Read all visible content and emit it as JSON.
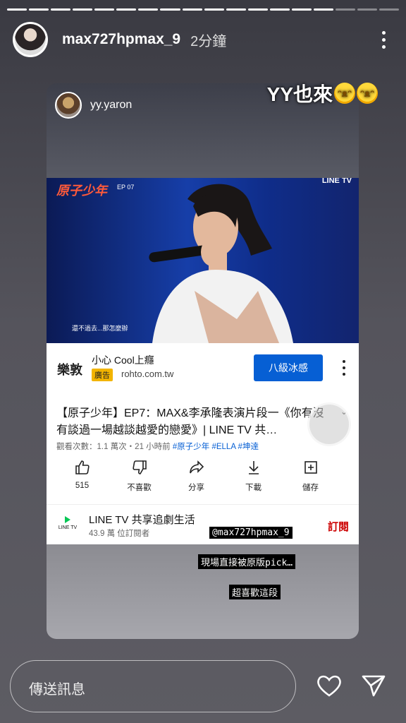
{
  "story": {
    "progress": {
      "total": 18,
      "completed": 15
    },
    "header": {
      "username": "max727hpmax_9",
      "time": "2分鐘"
    },
    "overlay_text": "YY也來",
    "overlay_emoji": [
      "rolling-on-floor-laughing",
      "rolling-on-floor-laughing"
    ],
    "reply_placeholder": "傳送訊息"
  },
  "shared_post": {
    "username": "yy.yaron",
    "video": {
      "show_logo": "原子少年",
      "episode": "EP 07",
      "watermark": "LINE TV",
      "subtitle": "還不過去...那怎麼辦"
    },
    "ad": {
      "logo": "樂敦",
      "name": "小心 Cool上癮",
      "badge": "廣告",
      "domain": "rohto.com.tw",
      "cta": "八級冰感"
    },
    "video_title": "【原子少年】EP7：MAX&李承隆表演片段一《你有沒有談過一場越談越愛的戀愛》| LINE TV 共…",
    "meta": "觀看次數：1.1 萬次・21 小時前 ",
    "tags": "#原子少年 #ELLA #坤達",
    "actions": [
      {
        "icon": "thumbs-up-icon",
        "label": "515"
      },
      {
        "icon": "thumbs-down-icon",
        "label": "不喜歡"
      },
      {
        "icon": "share-icon",
        "label": "分享"
      },
      {
        "icon": "download-icon",
        "label": "下載"
      },
      {
        "icon": "save-icon",
        "label": "儲存"
      }
    ],
    "channel": {
      "logo_text": "LINE TV",
      "name": "LINE TV 共享追劇生活",
      "subscribers": "43.9 萬 位訂閱者",
      "subscribe": "訂閱"
    }
  },
  "stickers": {
    "mention": "@max727hpmax_9",
    "line1": "現場直接被原版pick…",
    "line2": "超喜歡這段"
  },
  "colors": {
    "subscribe": "#cc0000",
    "cta": "#065fd4",
    "tags": "#065fd4",
    "ad_badge": "#f2b400"
  }
}
